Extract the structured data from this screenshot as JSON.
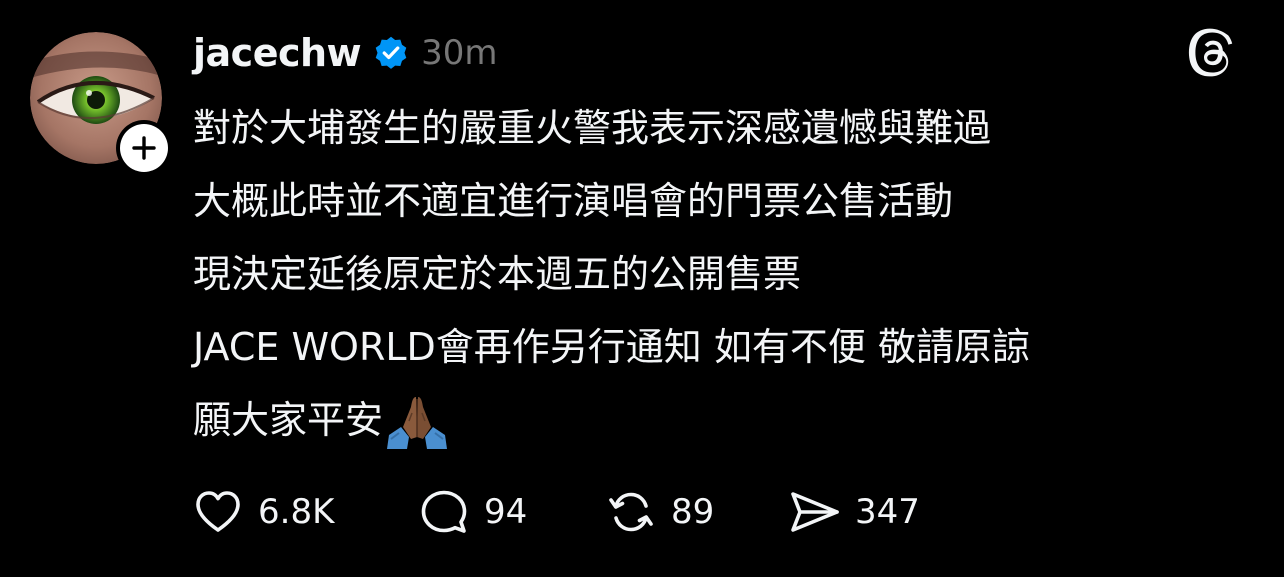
{
  "post": {
    "username": "jacechw",
    "timestamp": "30m",
    "verified": true,
    "body_lines": [
      "對於大埔發生的嚴重火警我表示深感遺憾與難過",
      "大概此時並不適宜進行演唱會的門票公售活動",
      "現決定延後原定於本週五的公開售票",
      "JACE WORLD會再作另行通知 如有不便 敬請原諒"
    ],
    "blessing": "願大家平安",
    "blessing_emoji": "folded-hands-medium-dark-skin-tone"
  },
  "actions": {
    "likes": "6.8K",
    "replies": "94",
    "reposts": "89",
    "shares": "347"
  },
  "colors": {
    "background": "#000000",
    "text": "#f3f5f7",
    "muted": "#777777",
    "verified_blue": "#0095f6"
  },
  "icons": [
    "threads-logo-icon",
    "verified-badge-icon",
    "plus-icon",
    "heart-icon",
    "comment-icon",
    "repost-icon",
    "share-icon"
  ]
}
